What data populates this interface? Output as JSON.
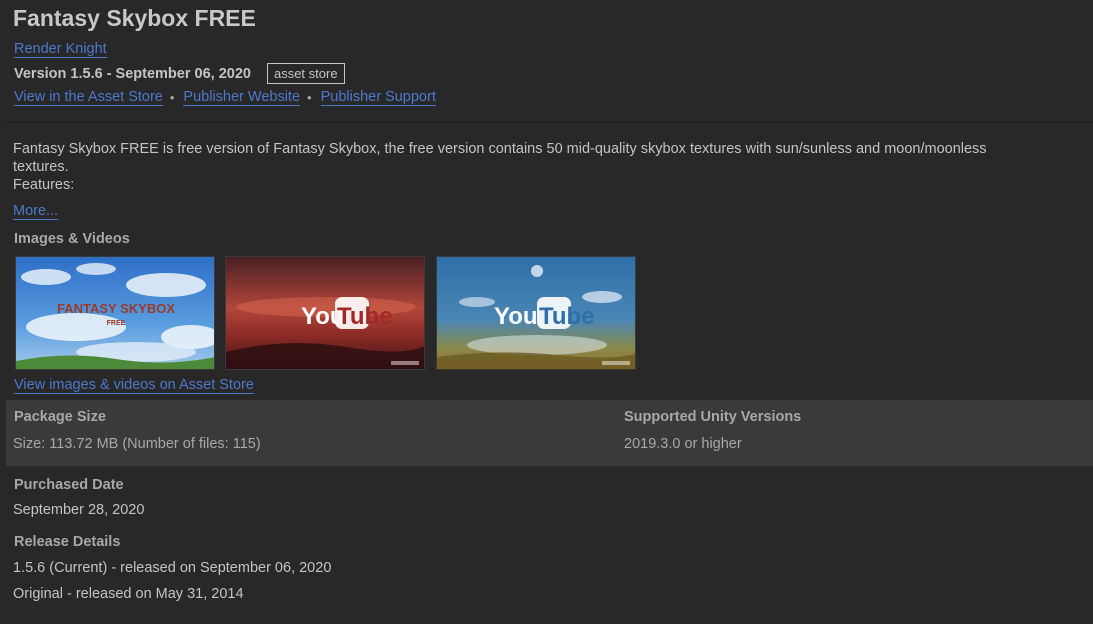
{
  "package": {
    "title": "Fantasy Skybox FREE",
    "author": "Render Knight",
    "version": "Version 1.5.6 - September 06, 2020",
    "source_tag": "asset store"
  },
  "links": {
    "asset_store": "View in the Asset Store",
    "publisher_website": "Publisher Website",
    "publisher_support": "Publisher Support",
    "separator": "•"
  },
  "description": {
    "lines": [
      "Fantasy Skybox FREE is free version of Fantasy Skybox, the free version contains 50 mid-quality skybox textures with sun/sunless and moon/moonless",
      "textures.",
      "Features:"
    ],
    "more_label": "More..."
  },
  "media": {
    "section_label": "Images & Videos",
    "thumbnails": [
      {
        "kind": "image",
        "overlay_title": "FANTASY SKYBOX",
        "overlay_sub": "FREE"
      },
      {
        "kind": "video",
        "overlay_you": "You",
        "overlay_tube": "Tube"
      },
      {
        "kind": "video",
        "overlay_you": "You",
        "overlay_tube": "Tube"
      }
    ],
    "view_link": "View images & videos on Asset Store"
  },
  "details": {
    "package_size_label": "Package Size",
    "package_size_value": "Size: 113.72 MB (Number of files: 115)",
    "unity_versions_label": "Supported Unity Versions",
    "unity_versions_value": "2019.3.0 or higher",
    "purchased_label": "Purchased Date",
    "purchased_value": "September 28, 2020",
    "release_label": "Release Details",
    "release_current": "1.5.6 (Current) - released on September 06, 2020",
    "release_original": "Original - released on May 31, 2014"
  },
  "colors": {
    "background": "#282828",
    "link": "#4d78cc",
    "band": "#3a3a3a",
    "text": "#c4c4c4",
    "label": "#a8a8a8"
  }
}
